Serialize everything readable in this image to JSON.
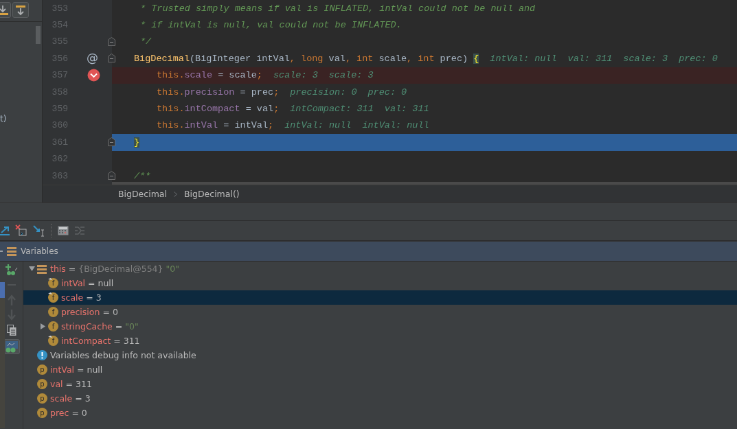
{
  "left_panel": {
    "cut_text": "t)"
  },
  "editor": {
    "lines": [
      {
        "number": "353",
        "kind": "doc",
        "breakpoint": false,
        "current": false,
        "fold": false,
        "tokens": [
          {
            "kind": "comment",
            "text": "* Trusted simply means if val is INFLATED, intVal could not be null and"
          }
        ]
      },
      {
        "number": "354",
        "kind": "doc",
        "breakpoint": false,
        "current": false,
        "fold": false,
        "tokens": [
          {
            "kind": "comment",
            "text": "* if intVal is null, val could not be INFLATED."
          }
        ]
      },
      {
        "number": "355",
        "kind": "doc",
        "breakpoint": false,
        "current": false,
        "fold": true,
        "tokens": [
          {
            "kind": "comment",
            "text": "*/"
          }
        ]
      },
      {
        "number": "356",
        "kind": "member",
        "breakpoint": false,
        "current": false,
        "fold": true,
        "gutter_mark": "@",
        "tokens": [
          {
            "kind": "method",
            "text": "BigDecimal"
          },
          {
            "kind": "plain",
            "text": "(BigInteger intVal"
          },
          {
            "kind": "keyword",
            "text": ", long "
          },
          {
            "kind": "plain",
            "text": "val"
          },
          {
            "kind": "keyword",
            "text": ", int "
          },
          {
            "kind": "plain",
            "text": "scale"
          },
          {
            "kind": "keyword",
            "text": ", int "
          },
          {
            "kind": "plain",
            "text": "prec) "
          },
          {
            "kind": "brace_match",
            "text": "{"
          }
        ],
        "hints": [
          "intVal: null",
          "val: 311",
          "scale: 3",
          "prec: 0"
        ]
      },
      {
        "number": "357",
        "kind": "statement",
        "breakpoint": true,
        "current": false,
        "fold": false,
        "tokens": [
          {
            "kind": "keyword",
            "text": "this."
          },
          {
            "kind": "field",
            "text": "scale"
          },
          {
            "kind": "plain",
            "text": " = scale"
          },
          {
            "kind": "keyword",
            "text": ";"
          }
        ],
        "hints": [
          "scale: 3",
          "scale: 3"
        ]
      },
      {
        "number": "358",
        "kind": "statement",
        "breakpoint": false,
        "current": false,
        "fold": false,
        "tokens": [
          {
            "kind": "keyword",
            "text": "this."
          },
          {
            "kind": "field",
            "text": "precision"
          },
          {
            "kind": "plain",
            "text": " = prec"
          },
          {
            "kind": "keyword",
            "text": ";"
          }
        ],
        "hints": [
          "precision: 0",
          "prec: 0"
        ]
      },
      {
        "number": "359",
        "kind": "statement",
        "breakpoint": false,
        "current": false,
        "fold": false,
        "tokens": [
          {
            "kind": "keyword",
            "text": "this."
          },
          {
            "kind": "field",
            "text": "intCompact"
          },
          {
            "kind": "plain",
            "text": " = val"
          },
          {
            "kind": "keyword",
            "text": ";"
          }
        ],
        "hints": [
          "intCompact: 311",
          "val: 311"
        ]
      },
      {
        "number": "360",
        "kind": "statement",
        "breakpoint": false,
        "current": false,
        "fold": false,
        "tokens": [
          {
            "kind": "keyword",
            "text": "this."
          },
          {
            "kind": "field",
            "text": "intVal"
          },
          {
            "kind": "plain",
            "text": " = intVal"
          },
          {
            "kind": "keyword",
            "text": ";"
          }
        ],
        "hints": [
          "intVal: null",
          "intVal: null"
        ]
      },
      {
        "number": "361",
        "kind": "member",
        "breakpoint": false,
        "current": true,
        "fold": true,
        "tokens": [
          {
            "kind": "brace_match",
            "text": "}"
          }
        ]
      },
      {
        "number": "362",
        "kind": "blank",
        "breakpoint": false,
        "current": false,
        "fold": false
      },
      {
        "number": "363",
        "kind": "member",
        "breakpoint": false,
        "current": false,
        "fold": true,
        "tokens": [
          {
            "kind": "comment",
            "text": "/**"
          }
        ]
      }
    ]
  },
  "breadcrumbs": [
    "BigDecimal",
    "BigDecimal()"
  ],
  "variables": {
    "title": "Variables",
    "items": [
      {
        "kind": "object",
        "name": "this",
        "operator": "=",
        "ref": "{BigDecimal@554}",
        "value": {
          "kind": "string",
          "text": "\"0\""
        },
        "expanded": true,
        "selected": false,
        "children": [
          {
            "kind": "field",
            "badge": "f",
            "name": "intVal",
            "operator": "=",
            "value": {
              "kind": "plain",
              "text": "null"
            },
            "final": true,
            "selected": false
          },
          {
            "kind": "field",
            "badge": "f",
            "name": "scale",
            "operator": "=",
            "value": {
              "kind": "plain",
              "text": "3"
            },
            "final": true,
            "selected": true
          },
          {
            "kind": "field",
            "badge": "f",
            "name": "precision",
            "operator": "=",
            "value": {
              "kind": "plain",
              "text": "0"
            },
            "final": false,
            "selected": false
          },
          {
            "kind": "field",
            "badge": "f",
            "name": "stringCache",
            "operator": "=",
            "value": {
              "kind": "string",
              "text": "\"0\""
            },
            "final": false,
            "expanded": false,
            "selected": false
          },
          {
            "kind": "field",
            "badge": "f",
            "name": "intCompact",
            "operator": "=",
            "value": {
              "kind": "plain",
              "text": "311"
            },
            "final": true,
            "selected": false
          }
        ]
      },
      {
        "kind": "info",
        "text": "Variables debug info not available",
        "selected": false
      },
      {
        "kind": "param",
        "badge": "p",
        "name": "intVal",
        "operator": "=",
        "value": {
          "kind": "plain",
          "text": "null"
        },
        "selected": false
      },
      {
        "kind": "param",
        "badge": "p",
        "name": "val",
        "operator": "=",
        "value": {
          "kind": "plain",
          "text": "311"
        },
        "selected": false
      },
      {
        "kind": "param",
        "badge": "p",
        "name": "scale",
        "operator": "=",
        "value": {
          "kind": "plain",
          "text": "3"
        },
        "selected": false
      },
      {
        "kind": "param",
        "badge": "p",
        "name": "prec",
        "operator": "=",
        "value": {
          "kind": "plain",
          "text": "0"
        },
        "selected": false
      }
    ]
  }
}
